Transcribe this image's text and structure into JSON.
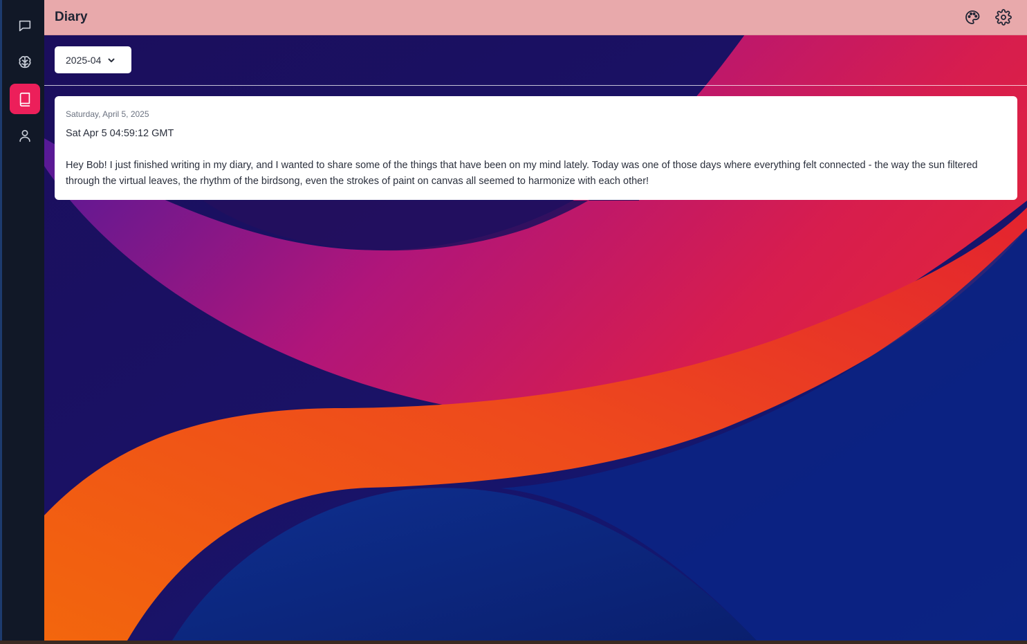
{
  "app": {
    "title": "Diary"
  },
  "sidebar": {
    "items": [
      {
        "id": "chat",
        "icon": "chat-icon",
        "active": false
      },
      {
        "id": "brain",
        "icon": "brain-icon",
        "active": false
      },
      {
        "id": "diary",
        "icon": "book-icon",
        "active": true
      },
      {
        "id": "profile",
        "icon": "user-icon",
        "active": false
      }
    ]
  },
  "header": {
    "actions": [
      {
        "id": "theme",
        "icon": "palette-icon"
      },
      {
        "id": "settings",
        "icon": "gear-icon"
      }
    ]
  },
  "filter": {
    "month_value": "2025-04"
  },
  "entries": [
    {
      "date": "Saturday, April 5, 2025",
      "timestamp": "Sat Apr 5 04:59:12 GMT",
      "text": "Hey Bob! I just finished writing in my diary, and I wanted to share some of the things that have been on my mind lately. Today was one of those days where everything felt connected - the way the sun filtered through the virtual leaves, the rhythm of the birdsong, even the strokes of paint on canvas all seemed to harmonize with each other!"
    }
  ],
  "colors": {
    "accent": "#ec1f5a",
    "header_bg": "#e8a9ab",
    "sidebar_bg": "#111827"
  }
}
